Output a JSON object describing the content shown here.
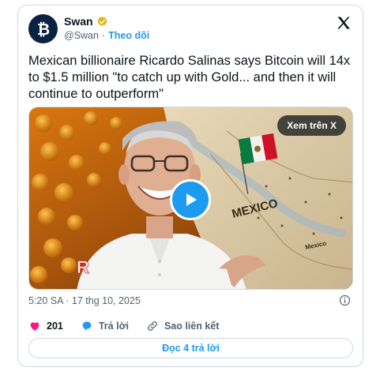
{
  "author": {
    "name": "Swan",
    "handle": "@Swan",
    "separator": "·",
    "follow_label": "Theo dõi"
  },
  "tweet": {
    "text": "Mexican billionaire Ricardo Salinas says Bitcoin will 14x to $1.5 million \"to catch up with Gold... and then it will continue to outperform\""
  },
  "media": {
    "view_on_x_label": "Xem trên X",
    "map_labels": [
      "MEXICO",
      "Mexico"
    ]
  },
  "timestamp": "5:20 SA · 17 thg 10, 2025",
  "actions": {
    "like_count": "201",
    "reply_label": "Trả lời",
    "copy_link_label": "Sao liên kết"
  },
  "read_replies_label": "Đọc 4 trả lời",
  "colors": {
    "accent": "#1d9bf0",
    "like": "#f91880",
    "text": "#0f1419",
    "muted": "#536471",
    "verified": "#e2b719"
  }
}
